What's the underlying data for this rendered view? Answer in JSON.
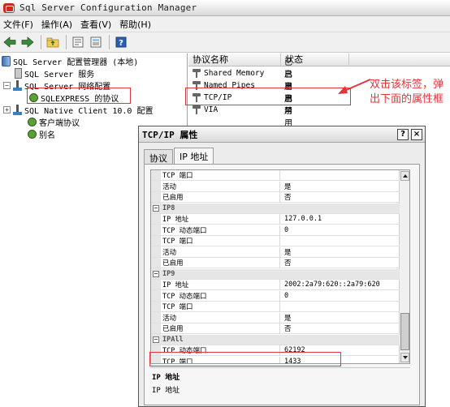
{
  "window": {
    "title": "Sql Server Configuration Manager"
  },
  "menu": [
    "文件(F)",
    "操作(A)",
    "查看(V)",
    "帮助(H)"
  ],
  "toolbar": {
    "icons": [
      "back-arrow-icon",
      "forward-arrow-icon",
      "up-folder-icon",
      "properties-icon",
      "export-list-icon",
      "help-icon"
    ]
  },
  "tree": {
    "root": "SQL Server 配置管理器 (本地)",
    "items": [
      {
        "label": "SQL Server 服务",
        "icon": "services-icon"
      },
      {
        "label": "SQL Server 网络配置",
        "icon": "network-icon",
        "expander": "−"
      },
      {
        "label": "SQLEXPRESS 的协议",
        "icon": "protocol-icon"
      },
      {
        "label": "SQL Native Client 10.0 配置",
        "icon": "native-client-icon",
        "expander": "+"
      },
      {
        "label": "客户端协议",
        "icon": "protocol-icon"
      },
      {
        "label": "别名",
        "icon": "alias-icon"
      }
    ],
    "root_expander": "−"
  },
  "list": {
    "columns": [
      "协议名称",
      "状态"
    ],
    "rows": [
      {
        "name": "Shared Memory",
        "status": "已启用"
      },
      {
        "name": "Named Pipes",
        "status": "已启用"
      },
      {
        "name": "TCP/IP",
        "status": "已启用"
      },
      {
        "name": "VIA",
        "status": "已禁用"
      }
    ]
  },
  "annotation": {
    "line1": "双击该标签，弹",
    "line2": "出下面的属性框"
  },
  "dialog": {
    "title": "TCP/IP 属性",
    "help_btn": "?",
    "close_btn": "×",
    "tabs": [
      "协议",
      "IP 地址"
    ],
    "rows": [
      {
        "k": "TCP 端口",
        "v": ""
      },
      {
        "k": "活动",
        "v": "是"
      },
      {
        "k": "已启用",
        "v": "否"
      },
      {
        "k": "IP8",
        "v": "",
        "cat": true
      },
      {
        "k": "IP 地址",
        "v": "127.0.0.1"
      },
      {
        "k": "TCP 动态端口",
        "v": "0"
      },
      {
        "k": "TCP 端口",
        "v": ""
      },
      {
        "k": "活动",
        "v": "是"
      },
      {
        "k": "已启用",
        "v": "否"
      },
      {
        "k": "IP9",
        "v": "",
        "cat": true
      },
      {
        "k": "IP 地址",
        "v": "2002:2a79:620::2a79:620"
      },
      {
        "k": "TCP 动态端口",
        "v": "0"
      },
      {
        "k": "TCP 端口",
        "v": ""
      },
      {
        "k": "活动",
        "v": "是"
      },
      {
        "k": "已启用",
        "v": "否"
      },
      {
        "k": "IPAll",
        "v": "",
        "cat": true
      },
      {
        "k": "TCP 动态端口",
        "v": "62192"
      },
      {
        "k": "TCP 端口",
        "v": "1433"
      }
    ],
    "description": {
      "title": "IP 地址",
      "text": "IP 地址"
    }
  },
  "colors": {
    "annotation": "#e0353a",
    "accent": "#3a7fc0"
  }
}
